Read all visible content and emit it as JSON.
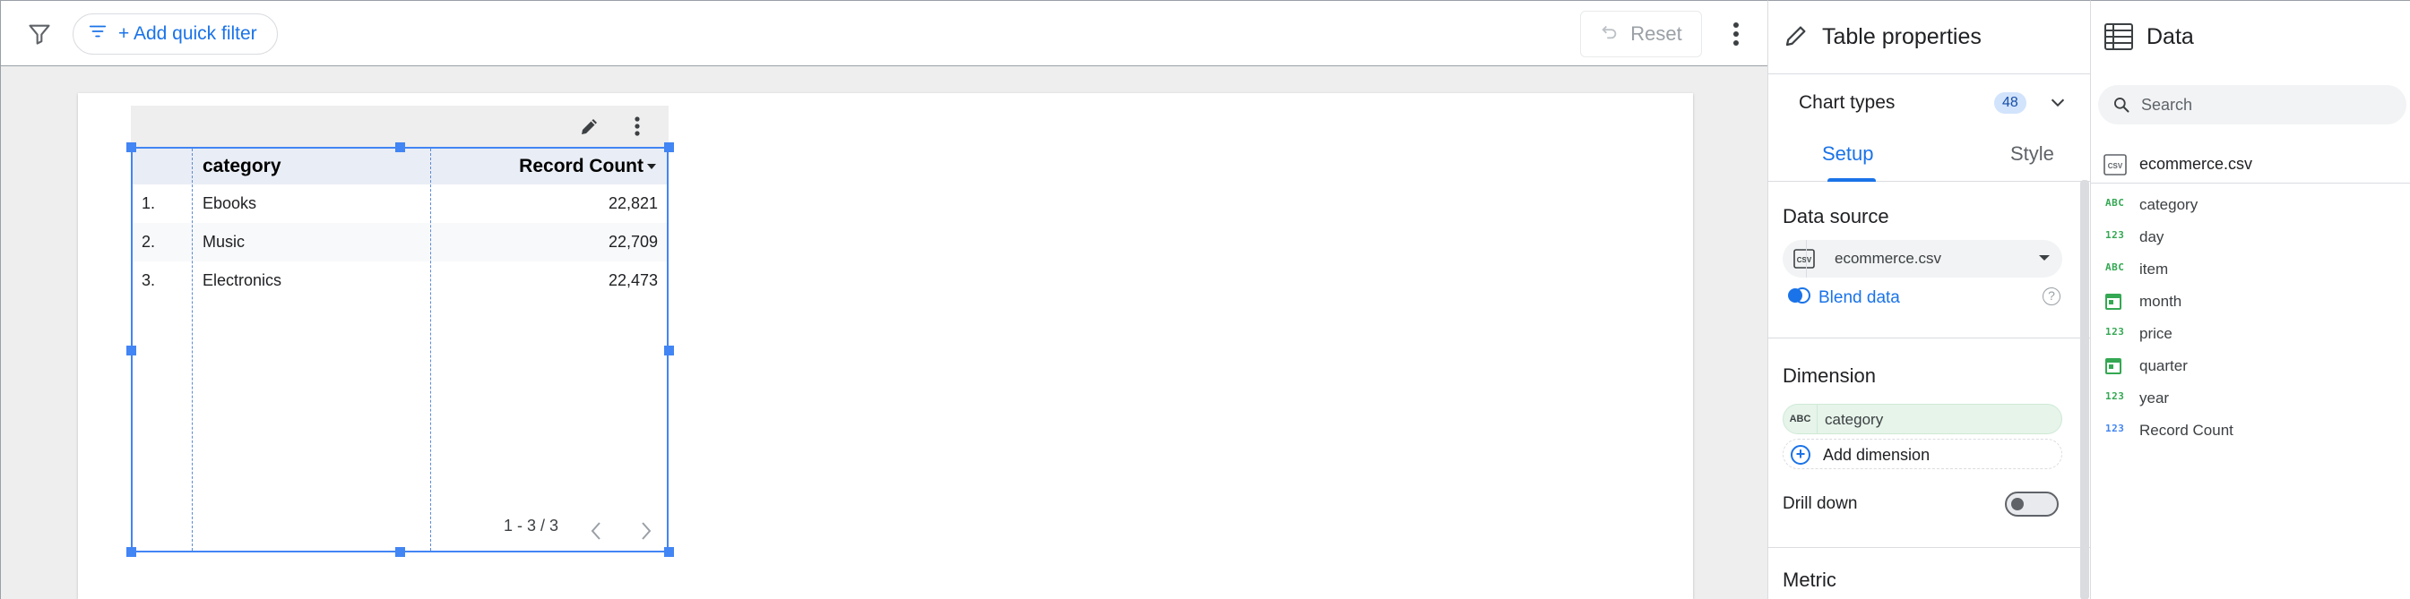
{
  "toolbar": {
    "add_quick_filter_label": "+ Add quick filter",
    "reset_label": "Reset"
  },
  "table": {
    "columns": [
      "category",
      "Record Count"
    ],
    "rows": [
      {
        "index": "1.",
        "category": "Ebooks",
        "count": "22,821"
      },
      {
        "index": "2.",
        "category": "Music",
        "count": "22,709"
      },
      {
        "index": "3.",
        "category": "Electronics",
        "count": "22,473"
      }
    ],
    "pagination": "1 - 3 / 3"
  },
  "properties": {
    "title": "Table properties",
    "chart_types_label": "Chart types",
    "chart_types_count": "48",
    "tabs": [
      "Setup",
      "Style"
    ],
    "active_tab": "Setup",
    "data_source_heading": "Data source",
    "data_source_value": "ecommerce.csv",
    "data_source_icon_text": "CSV",
    "blend_data_label": "Blend data",
    "blend_help": "?",
    "dimension_heading": "Dimension",
    "dimension_chip": "category",
    "dimension_chip_type": "ABC",
    "add_dimension_label": "Add dimension",
    "drill_down_label": "Drill down",
    "drill_down_enabled": false,
    "metric_heading": "Metric"
  },
  "data_panel": {
    "title": "Data",
    "search_placeholder": "Search",
    "source_name": "ecommerce.csv",
    "source_icon_text": "CSV",
    "fields": [
      {
        "type": "ABC",
        "name": "category",
        "kind": "text"
      },
      {
        "type": "123",
        "name": "day",
        "kind": "number"
      },
      {
        "type": "ABC",
        "name": "item",
        "kind": "text"
      },
      {
        "type": "date",
        "name": "month",
        "kind": "date"
      },
      {
        "type": "123",
        "name": "price",
        "kind": "number"
      },
      {
        "type": "date",
        "name": "quarter",
        "kind": "date"
      },
      {
        "type": "123",
        "name": "year",
        "kind": "number"
      },
      {
        "type": "123",
        "name": "Record Count",
        "kind": "metric"
      }
    ]
  },
  "colors": {
    "accent": "#1a73e8",
    "selection": "#4285f4",
    "dimension_green": "#34a853",
    "metric_blue": "#4285f4"
  }
}
